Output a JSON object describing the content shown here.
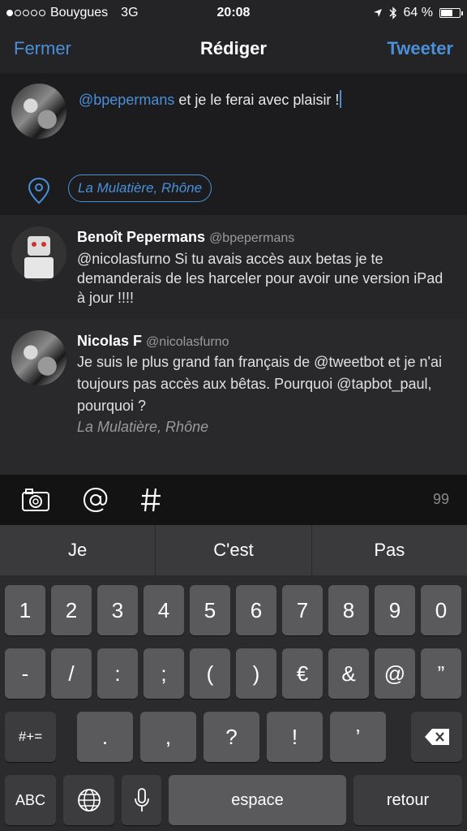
{
  "status": {
    "carrier": "Bouygues",
    "network": "3G",
    "time": "20:08",
    "battery": "64 %",
    "battery_level": 0.64
  },
  "nav": {
    "close_label": "Fermer",
    "title": "Rédiger",
    "tweet_label": "Tweeter"
  },
  "compose": {
    "mention": "@bpepermans",
    "text": " et je le ferai avec plaisir !",
    "location": "La Mulatière, Rhône"
  },
  "tweets": [
    {
      "name": "Benoît Pepermans",
      "handle": "@bpepermans",
      "text": "@nicolasfurno Si tu avais accès aux betas je te demanderais de les harceler pour avoir une version iPad à jour !!!!"
    },
    {
      "name": "Nicolas F",
      "handle": "@nicolasfurno",
      "text": "Je suis le plus grand fan français de @tweetbot et je n'ai toujours pas accès aux bêtas. Pourquoi @tapbot_paul, pourquoi ?",
      "location": "La Mulatière, Rhône"
    }
  ],
  "toolbar": {
    "char_count": "99"
  },
  "suggestions": [
    "Je",
    "C'est",
    "Pas"
  ],
  "keyboard": {
    "row1": [
      "1",
      "2",
      "3",
      "4",
      "5",
      "6",
      "7",
      "8",
      "9",
      "0"
    ],
    "row2": [
      "-",
      "/",
      ":",
      ";",
      "(",
      ")",
      "€",
      "&",
      "@",
      "”"
    ],
    "row3": [
      ".",
      ",",
      "?",
      "!",
      "’"
    ],
    "more_symbols": "#+=",
    "abc": "ABC",
    "space": "espace",
    "return": "retour"
  },
  "colors": {
    "accent": "#4a90d9",
    "background": "#1c1c1e"
  },
  "icons": [
    "signal-dots-icon",
    "location-arrow-icon",
    "bluetooth-icon",
    "battery-icon",
    "location-pin-icon",
    "camera-icon",
    "at-icon",
    "hashtag-icon",
    "backspace-icon",
    "globe-icon",
    "microphone-icon"
  ]
}
